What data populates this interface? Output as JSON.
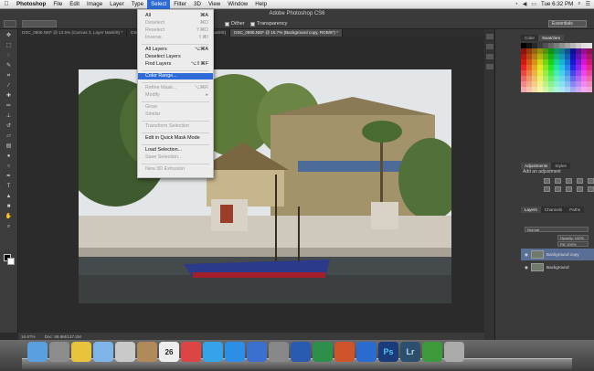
{
  "menubar": {
    "apple_icon": "apple-icon",
    "items": [
      "Photoshop",
      "File",
      "Edit",
      "Image",
      "Layer",
      "Type",
      "Select",
      "Filter",
      "3D",
      "View",
      "Window",
      "Help"
    ],
    "clock": "Tue 6:32 PM"
  },
  "window": {
    "title": "Adobe Photoshop CS6"
  },
  "options_bar": {
    "dither_label": "Dither",
    "transparency_label": "Transparency",
    "workspace": "Essentials"
  },
  "doc_tabs": [
    "DSC_0806.NEF @ 12.5% (Canvas 3, Layer Mask/8) *",
    "DSC_0437.jpg @ 16.7% (Canvas 3, Layer Mask/8)",
    "DSC_0806.NEF @ 16.7% (Background copy, RGB/8*) *"
  ],
  "status_bar": {
    "zoom": "16.67%",
    "doc_size": "Doc: 68.6M/137.2M"
  },
  "select_menu": {
    "items": [
      {
        "label": "All",
        "shortcut": "⌘A",
        "disabled": false
      },
      {
        "label": "Deselect",
        "shortcut": "⌘D",
        "disabled": true
      },
      {
        "label": "Reselect",
        "shortcut": "⇧⌘D",
        "disabled": true
      },
      {
        "label": "Inverse",
        "shortcut": "⇧⌘I",
        "disabled": true
      },
      {
        "label": "All Layers",
        "shortcut": "⌥⌘A",
        "disabled": false
      },
      {
        "label": "Deselect Layers",
        "shortcut": "",
        "disabled": false
      },
      {
        "label": "Find Layers",
        "shortcut": "⌥⇧⌘F",
        "disabled": false
      },
      {
        "label": "Color Range...",
        "shortcut": "",
        "disabled": false
      },
      {
        "label": "Refine Mask...",
        "shortcut": "⌥⌘R",
        "disabled": true
      },
      {
        "label": "Modify",
        "shortcut": "▸",
        "disabled": true
      },
      {
        "label": "Grow",
        "shortcut": "",
        "disabled": true
      },
      {
        "label": "Similar",
        "shortcut": "",
        "disabled": true
      },
      {
        "label": "Transform Selection",
        "shortcut": "",
        "disabled": true
      },
      {
        "label": "Edit in Quick Mask Mode",
        "shortcut": "",
        "disabled": false
      },
      {
        "label": "Load Selection...",
        "shortcut": "",
        "disabled": false
      },
      {
        "label": "Save Selection...",
        "shortcut": "",
        "disabled": true
      },
      {
        "label": "New 3D Extrusion",
        "shortcut": "",
        "disabled": true
      }
    ],
    "highlighted": "Color Range..."
  },
  "right_panel": {
    "color_tabs": [
      "Color",
      "Swatches"
    ],
    "adjust_tabs": [
      "Adjustments",
      "Styles"
    ],
    "adjust_label": "Add an adjustment",
    "layer_tabs": [
      "Layers",
      "Channels",
      "Paths"
    ],
    "blend_mode": "Normal",
    "opacity_label": "Opacity: 100%",
    "fill_label": "Fill: 100%",
    "layers": [
      "Background copy",
      "Background"
    ]
  },
  "dock": {
    "apps": [
      "finder-icon",
      "launchpad-icon",
      "chrome-icon",
      "preview-icon",
      "mail-icon",
      "contacts-icon",
      "calendar-icon",
      "ical-icon",
      "itunes-icon",
      "appstore-icon",
      "safari-icon",
      "prefs-icon",
      "word-icon",
      "excel-icon",
      "powerpoint-icon",
      "outlook-icon",
      "photoshop-icon",
      "lightroom-icon",
      "evernote-icon",
      "trash-icon"
    ],
    "ps_label": "Ps",
    "lr_label": "Lr",
    "calendar_day": "26"
  },
  "colors": {
    "menu_highlight": "#2f6ad9",
    "layer_selected": "#5a6f96"
  }
}
